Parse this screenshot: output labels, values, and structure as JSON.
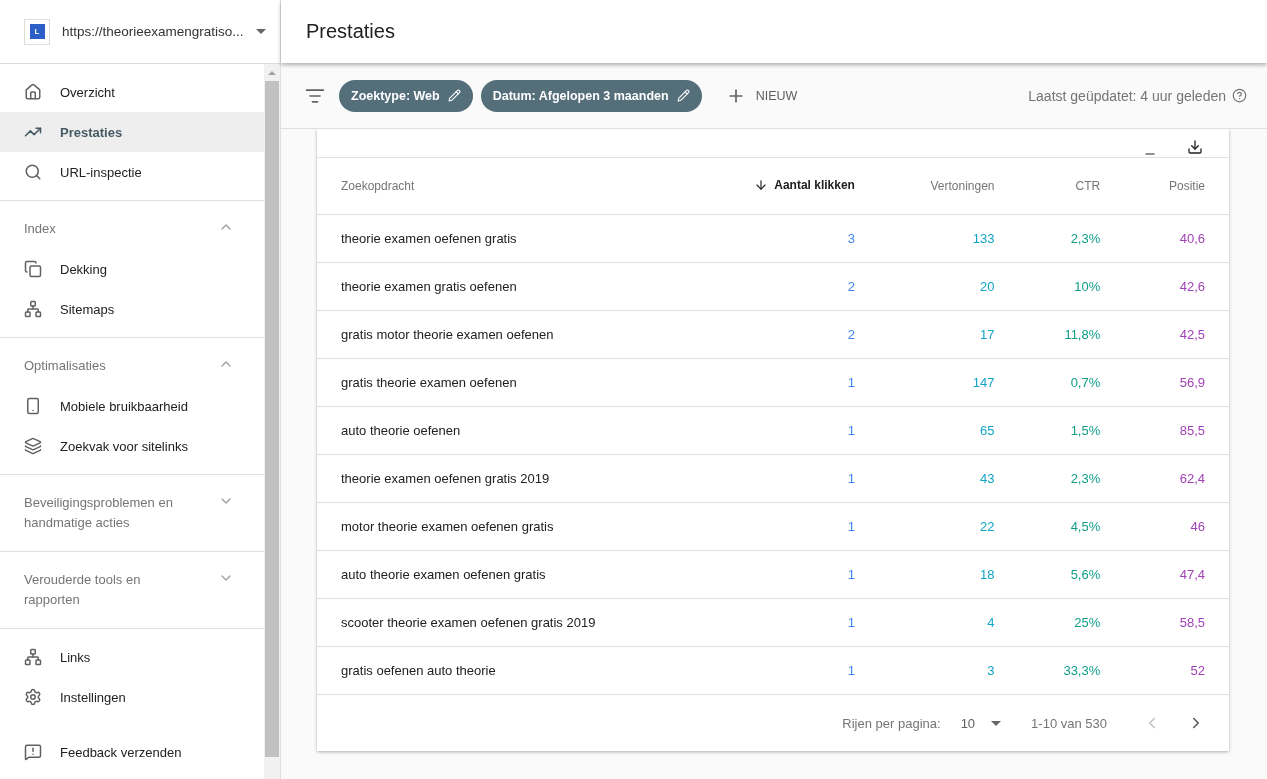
{
  "property": {
    "logo_letter": "L",
    "url": "https://theorieexamengratiso..."
  },
  "sidebar": {
    "sections": [
      {
        "items": [
          {
            "label": "Overzicht",
            "selected": false
          },
          {
            "label": "Prestaties",
            "selected": true
          },
          {
            "label": "URL-inspectie",
            "selected": false
          }
        ]
      },
      {
        "title": "Index",
        "expanded": true,
        "items": [
          {
            "label": "Dekking",
            "selected": false
          },
          {
            "label": "Sitemaps",
            "selected": false
          }
        ]
      },
      {
        "title": "Optimalisaties",
        "expanded": true,
        "items": [
          {
            "label": "Mobiele bruikbaarheid",
            "selected": false
          },
          {
            "label": "Zoekvak voor sitelinks",
            "selected": false
          }
        ]
      },
      {
        "title": "Beveiligingsproblemen en handmatige acties",
        "expanded": false
      },
      {
        "title": "Verouderde tools en rapporten",
        "expanded": false
      },
      {
        "items": [
          {
            "label": "Links",
            "selected": false
          },
          {
            "label": "Instellingen",
            "selected": false
          },
          {
            "label": "Feedback verzenden",
            "selected": false
          }
        ]
      }
    ]
  },
  "page_title": "Prestaties",
  "filters": [
    {
      "label": "Zoektype: Web"
    },
    {
      "label": "Datum: Afgelopen 3 maanden"
    }
  ],
  "new_filter": "NIEUW",
  "last_updated": "Laatst geüpdatet: 4 uur geleden",
  "table": {
    "columns": [
      {
        "label": "Zoekopdracht",
        "sorted": false
      },
      {
        "label": "Aantal klikken",
        "sorted": true,
        "color": "#4285f4"
      },
      {
        "label": "Vertoningen",
        "sorted": false,
        "color": "#12a4c4"
      },
      {
        "label": "CTR",
        "sorted": false,
        "color": "#0f9d88"
      },
      {
        "label": "Positie",
        "sorted": false,
        "color": "#a142b4"
      }
    ],
    "rows": [
      [
        "theorie examen oefenen gratis",
        "3",
        "133",
        "2,3%",
        "40,6"
      ],
      [
        "theorie examen gratis oefenen",
        "2",
        "20",
        "10%",
        "42,6"
      ],
      [
        "gratis motor theorie examen oefenen",
        "2",
        "17",
        "11,8%",
        "42,5"
      ],
      [
        "gratis theorie examen oefenen",
        "1",
        "147",
        "0,7%",
        "56,9"
      ],
      [
        "auto theorie oefenen",
        "1",
        "65",
        "1,5%",
        "85,5"
      ],
      [
        "theorie examen oefenen gratis 2019",
        "1",
        "43",
        "2,3%",
        "62,4"
      ],
      [
        "motor theorie examen oefenen gratis",
        "1",
        "22",
        "4,5%",
        "46"
      ],
      [
        "auto theorie examen oefenen gratis",
        "1",
        "18",
        "5,6%",
        "47,4"
      ],
      [
        "scooter theorie examen oefenen gratis 2019",
        "1",
        "4",
        "25%",
        "58,5"
      ],
      [
        "gratis oefenen auto theorie",
        "1",
        "3",
        "33,3%",
        "52"
      ]
    ]
  },
  "pagination": {
    "rows_label": "Rijen per pagina:",
    "rows_value": "10",
    "range": "1-10 van 530"
  }
}
